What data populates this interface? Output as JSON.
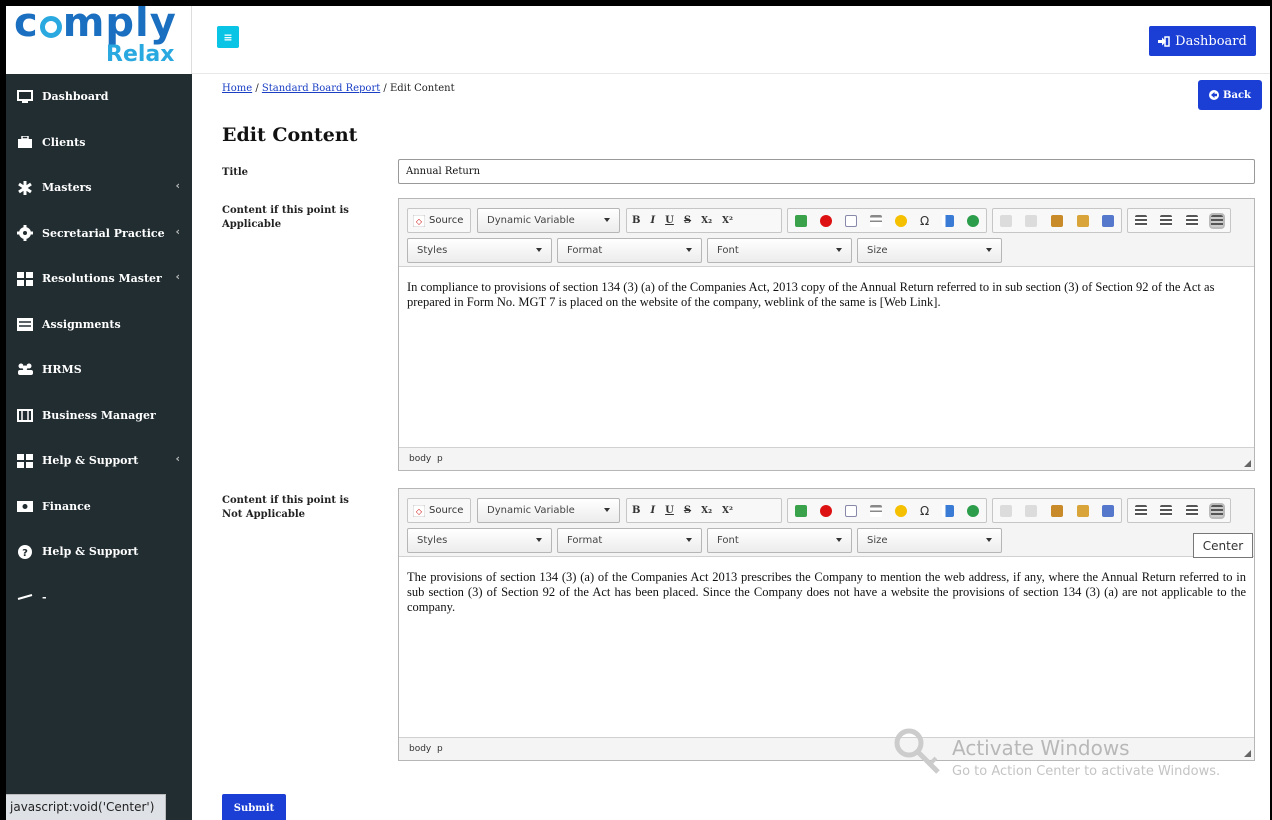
{
  "brand": {
    "logo_top": "comply",
    "logo_bottom": "Relax"
  },
  "sidebar": {
    "items": [
      {
        "label": "Dashboard",
        "icon": "monitor-icon",
        "has_children": false
      },
      {
        "label": "Clients",
        "icon": "briefcase-icon",
        "has_children": false
      },
      {
        "label": "Masters",
        "icon": "asterisk-icon",
        "has_children": true
      },
      {
        "label": "Secretarial Practice",
        "icon": "gear-icon",
        "has_children": true
      },
      {
        "label": "Resolutions Master",
        "icon": "grid-icon",
        "has_children": true
      },
      {
        "label": "Assignments",
        "icon": "tasks-icon",
        "has_children": false
      },
      {
        "label": "HRMS",
        "icon": "users-icon",
        "has_children": false
      },
      {
        "label": "Business Manager",
        "icon": "film-icon",
        "has_children": false
      },
      {
        "label": "Help & Support",
        "icon": "grid-icon",
        "has_children": true
      },
      {
        "label": "Finance",
        "icon": "money-icon",
        "has_children": false
      },
      {
        "label": "Help & Support",
        "icon": "question-icon",
        "has_children": false
      },
      {
        "label": "-",
        "icon": "signout-icon",
        "has_children": false
      }
    ],
    "chevron": "‹"
  },
  "status_bar": "javascript:void('Center')",
  "topbar": {
    "toggle_label": "≡",
    "dashboard_label": "Dashboard"
  },
  "breadcrumb": {
    "home": "Home",
    "sep": " / ",
    "parent": "Standard Board Report",
    "current": "Edit Content"
  },
  "back_label": "Back",
  "page_title": "Edit Content",
  "form": {
    "title_label": "Title",
    "title_value": "Annual Return",
    "applicable_label": "Content if this point is Applicable",
    "not_applicable_label": "Content if this point is Not Applicable",
    "submit_label": "Submit"
  },
  "editor": {
    "source_label": "Source",
    "dynamic_variable": "Dynamic Variable",
    "bold": "B",
    "italic": "I",
    "underline": "U",
    "strike": "S",
    "sub": "X₂",
    "sup": "X²",
    "styles": "Styles",
    "format": "Format",
    "font": "Font",
    "size": "Size",
    "path_body": "body",
    "path_p": "p"
  },
  "content_applicable": "In compliance to provisions of section 134 (3) (a) of the Companies Act, 2013 copy of the Annual Return referred to in sub section (3) of Section 92 of the Act as prepared in Form No. MGT 7 is placed on the website of the company, weblink of the same is [Web Link].",
  "content_not_applicable": "The provisions of section 134 (3) (a) of the Companies Act 2013 prescribes the Company to mention the web address, if any, where the Annual Return referred to in sub section (3) of Section 92 of the Act has been placed. Since the Company does not have a website the provisions of section 134 (3) (a) are not applicable to the company.",
  "tooltip": "Center",
  "watermark": {
    "line1": "Activate Windows",
    "line2": "Go to Action Center to activate Windows."
  },
  "colors": {
    "sidebar_bg": "#222d32",
    "primary_button": "#1b3fd4",
    "toggle": "#0ac4e6",
    "logo_blue": "#1a6fc0",
    "logo_cyan": "#2aa9e0"
  }
}
